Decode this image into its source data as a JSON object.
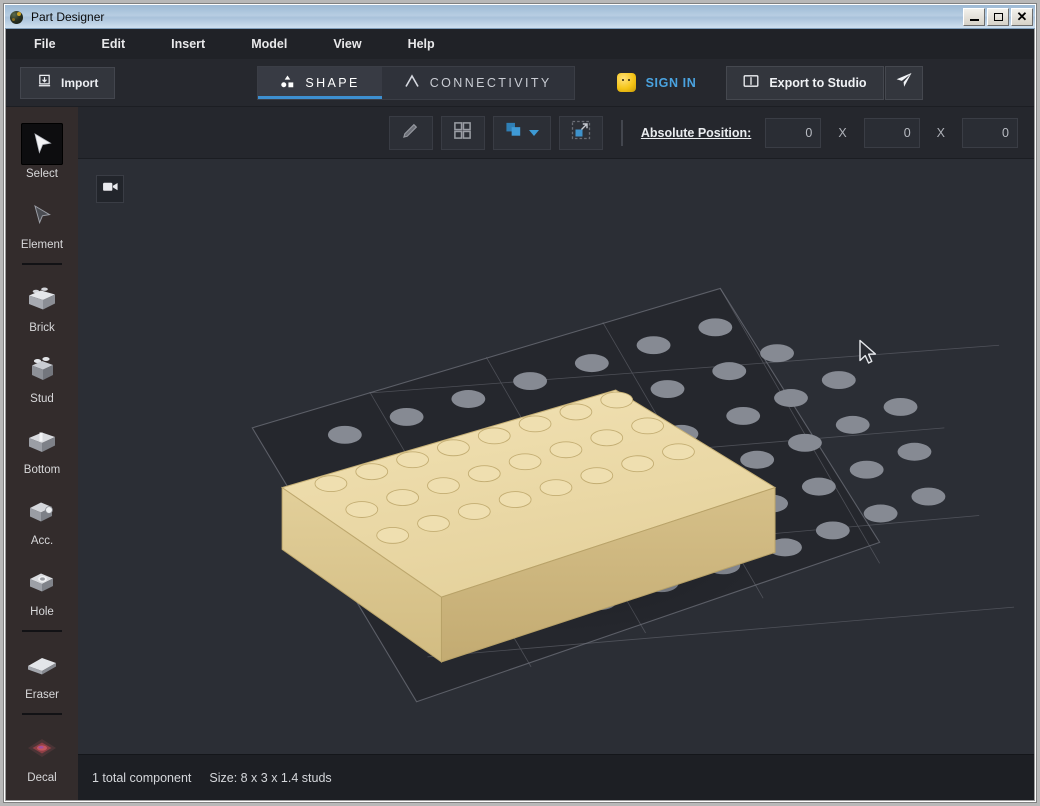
{
  "window": {
    "title": "Part Designer",
    "app_icon": "palette-sphere-icon",
    "controls": {
      "minimize": "minimize-icon",
      "maximize": "maximize-icon",
      "close": "close-icon"
    }
  },
  "menubar": {
    "items": [
      {
        "label": "File"
      },
      {
        "label": "Edit"
      },
      {
        "label": "Insert"
      },
      {
        "label": "Model"
      },
      {
        "label": "View"
      },
      {
        "label": "Help"
      }
    ]
  },
  "toolbar": {
    "import_label": "Import",
    "import_icon": "import-download-icon",
    "tabs": [
      {
        "label": "SHAPE",
        "icon": "shapes-icon",
        "active": true
      },
      {
        "label": "CONNECTIVITY",
        "icon": "connectivity-node-icon",
        "active": false
      }
    ],
    "signin_label": "SIGN IN",
    "signin_icon": "minifigure-head-icon",
    "export_label": "Export to Studio",
    "export_icon": "book-export-icon",
    "send_icon": "paper-plane-icon",
    "accent_color": "#3d8fd0",
    "signin_color": "#4aa3e0"
  },
  "subtoolbar": {
    "buttons": [
      {
        "name": "edit-pencil",
        "icon": "pencil-icon"
      },
      {
        "name": "grid-view",
        "icon": "grid-four-squares-icon"
      },
      {
        "name": "select-shape",
        "icon": "overlap-shapes-icon",
        "has_caret": true
      },
      {
        "name": "transform-scale",
        "icon": "scale-marquee-icon"
      }
    ],
    "absolute_position_label": "Absolute Position:",
    "position_values": [
      "0",
      "0",
      "0"
    ],
    "separator": "X"
  },
  "sidebar": {
    "tools": [
      {
        "label": "Select",
        "icon": "cursor-arrow-icon",
        "active": true,
        "sep_after": false
      },
      {
        "label": "Element",
        "icon": "cursor-outline-icon",
        "active": false,
        "sep_after": true
      },
      {
        "label": "Brick",
        "icon": "brick-icon",
        "active": false,
        "sep_after": false
      },
      {
        "label": "Stud",
        "icon": "stud-icon",
        "active": false,
        "sep_after": false
      },
      {
        "label": "Bottom",
        "icon": "brick-bottom-icon",
        "active": false,
        "sep_after": false
      },
      {
        "label": "Acc.",
        "icon": "accessory-icon",
        "active": false,
        "sep_after": false
      },
      {
        "label": "Hole",
        "icon": "hole-icon",
        "active": false,
        "sep_after": true
      },
      {
        "label": "Eraser",
        "icon": "eraser-icon",
        "active": false,
        "sep_after": true
      },
      {
        "label": "Decal",
        "icon": "decal-diamond-icon",
        "active": false,
        "sep_after": false
      }
    ]
  },
  "viewport": {
    "camera_button_icon": "video-camera-icon",
    "cursor_icon": "mouse-pointer-icon",
    "model": {
      "description": "tan LEGO brick on gray baseplate",
      "brick_color": "#e8d5a3",
      "brick_studs_cols": 8,
      "brick_studs_rows": 3,
      "baseplate_color": "#8d9098",
      "background_color": "#2b2e35"
    }
  },
  "statusbar": {
    "component_count": "1 total component",
    "size_text": "Size: 8 x 3 x 1.4 studs"
  }
}
